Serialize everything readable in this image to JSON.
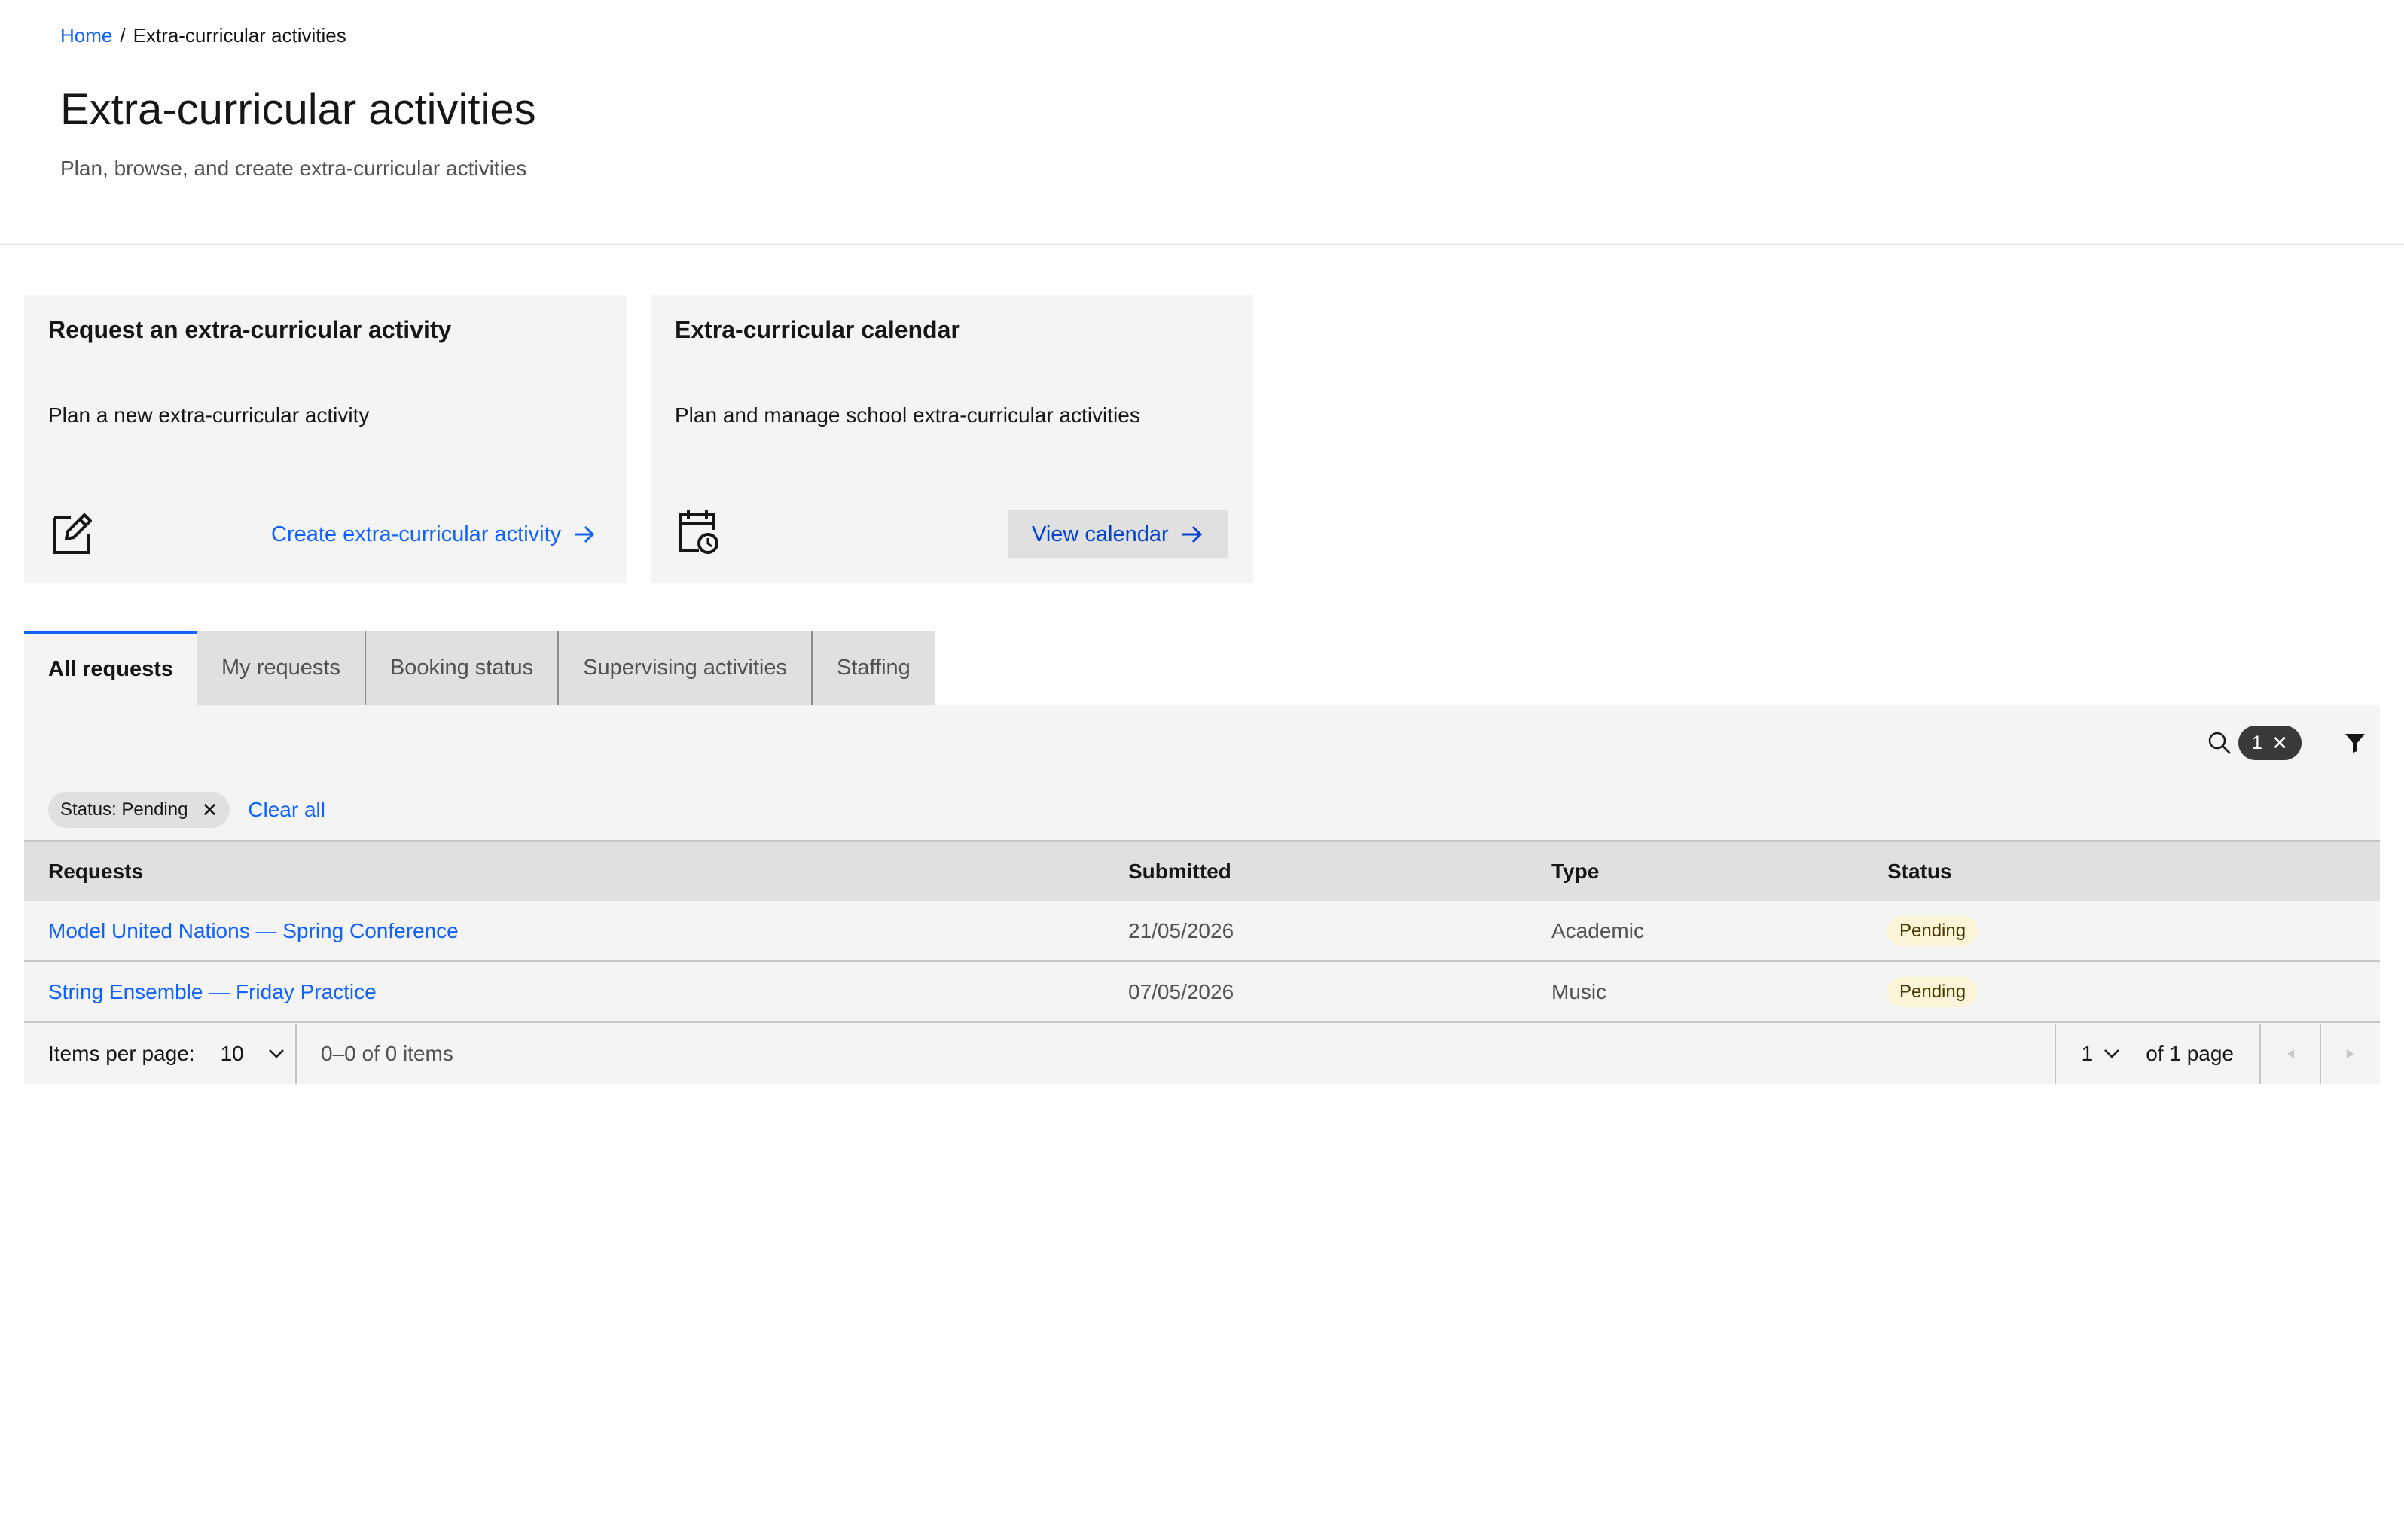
{
  "breadcrumb": {
    "home": "Home",
    "separator": "/",
    "current": "Extra-curricular activities"
  },
  "header": {
    "title": "Extra-curricular activities",
    "subtitle": "Plan, browse, and create extra-curricular activities"
  },
  "tiles": [
    {
      "title": "Request an extra-curricular activity",
      "description": "Plan a new extra-curricular activity",
      "icon": "edit-icon",
      "link_label": "Create extra-curricular activity"
    },
    {
      "title": "Extra-curricular calendar",
      "description": "Plan and manage school extra-curricular activities",
      "icon": "calendar-clock-icon",
      "link_label": "View calendar"
    }
  ],
  "tabs": [
    {
      "label": "All requests",
      "active": true
    },
    {
      "label": "My requests",
      "active": false
    },
    {
      "label": "Booking status",
      "active": false
    },
    {
      "label": "Supervising activities",
      "active": false
    },
    {
      "label": "Staffing",
      "active": false
    }
  ],
  "toolbar": {
    "filter_count": "1",
    "clear_glyph": "✕"
  },
  "filters": {
    "tags": [
      {
        "label": "Status: Pending"
      }
    ],
    "clear_all": "Clear all"
  },
  "table": {
    "columns": [
      "Requests",
      "Submitted",
      "Type",
      "Status"
    ],
    "rows": [
      {
        "request": "Model United Nations — Spring Conference",
        "submitted": "21/05/2026",
        "type": "Academic",
        "status": "Pending"
      },
      {
        "request": "String Ensemble — Friday Practice",
        "submitted": "07/05/2026",
        "type": "Music",
        "status": "Pending"
      }
    ]
  },
  "pagination": {
    "items_per_page_label": "Items per page:",
    "items_per_page": "10",
    "range": "0–0 of 0 items",
    "current_page": "1",
    "of_pages": "of 1 page"
  },
  "colors": {
    "link": "#0f62fe",
    "pending_bg": "#fcf4d6",
    "pending_text": "#483700",
    "tile_bg": "#f4f4f4"
  }
}
